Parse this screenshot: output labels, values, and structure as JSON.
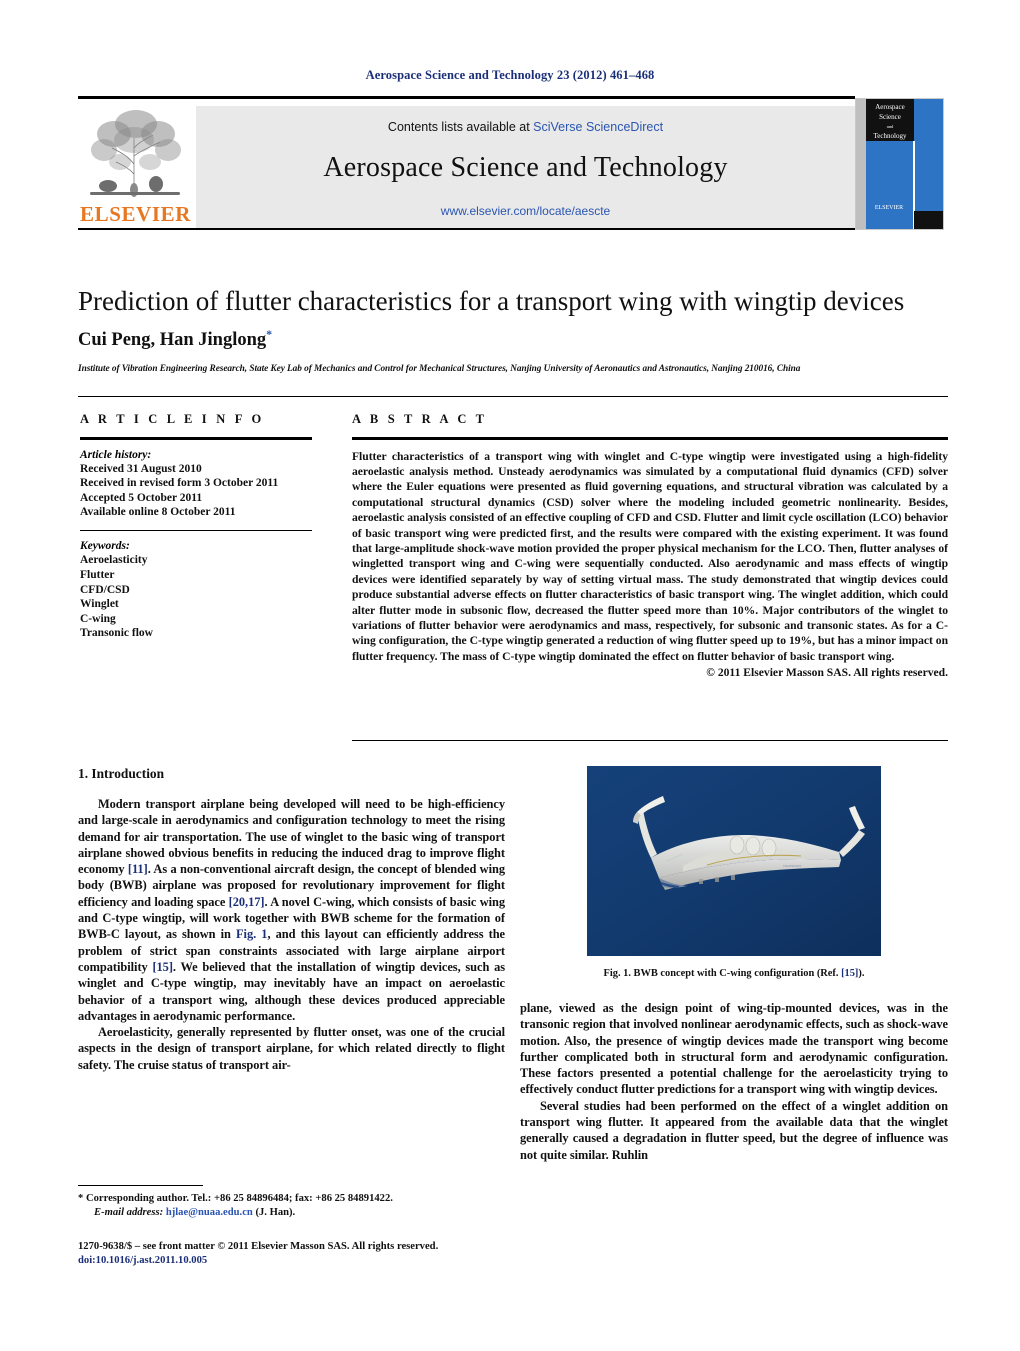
{
  "running_head": "Aerospace Science and Technology 23 (2012) 461–468",
  "masthead": {
    "contents_prefix": "Contents lists available at ",
    "sciencedirect": "SciVerse ScienceDirect",
    "journal_title": "Aerospace Science and Technology",
    "journal_url": "www.elsevier.com/locate/aescte",
    "publisher_wordmark": "ELSEVIER",
    "cover": {
      "line1": "Aerospace",
      "line2": "Science",
      "line3": "and",
      "line4": "Technology",
      "publisher": "ELSEVIER"
    }
  },
  "article": {
    "title": "Prediction of flutter characteristics for a transport wing with wingtip devices",
    "authors": "Cui Peng, Han Jinglong",
    "corresponding_marker": "*",
    "affiliation": "Institute of Vibration Engineering Research, State Key Lab of Mechanics and Control for Mechanical Structures, Nanjing University of Aeronautics and Astronautics, Nanjing 210016, China"
  },
  "article_info": {
    "heading": "A R T I C L E    I N F O",
    "history_label": "Article history:",
    "history": [
      "Received 31 August 2010",
      "Received in revised form 3 October 2011",
      "Accepted 5 October 2011",
      "Available online 8 October 2011"
    ],
    "keywords_label": "Keywords:",
    "keywords": [
      "Aeroelasticity",
      "Flutter",
      "CFD/CSD",
      "Winglet",
      "C-wing",
      "Transonic flow"
    ]
  },
  "abstract": {
    "heading": "A B S T R A C T",
    "text": "Flutter characteristics of a transport wing with winglet and C-type wingtip were investigated using a high-fidelity aeroelastic analysis method. Unsteady aerodynamics was simulated by a computational fluid dynamics (CFD) solver where the Euler equations were presented as fluid governing equations, and structural vibration was calculated by a computational structural dynamics (CSD) solver where the modeling included geometric nonlinearity. Besides, aeroelastic analysis consisted of an effective coupling of CFD and CSD. Flutter and limit cycle oscillation (LCO) behavior of basic transport wing were predicted first, and the results were compared with the existing experiment. It was found that large-amplitude shock-wave motion provided the proper physical mechanism for the LCO. Then, flutter analyses of wingletted transport wing and C-wing were sequentially conducted. Also aerodynamic and mass effects of wingtip devices were identified separately by way of setting virtual mass. The study demonstrated that wingtip devices could produce substantial adverse effects on flutter characteristics of basic transport wing. The winglet addition, which could alter flutter mode in subsonic flow, decreased the flutter speed more than 10%. Major contributors of the winglet to variations of flutter behavior were aerodynamics and mass, respectively, for subsonic and transonic states. As for a C-wing configuration, the C-type wingtip generated a reduction of wing flutter speed up to 19%, but has a minor impact on flutter frequency. The mass of C-type wingtip dominated the effect on flutter behavior of basic transport wing.",
    "copyright": "© 2011 Elsevier Masson SAS. All rights reserved."
  },
  "body": {
    "section1_heading": "1. Introduction",
    "para1_a": "Modern transport airplane being developed will need to be high-efficiency and large-scale in aerodynamics and configuration technology to meet the rising demand for air transportation. The use of winglet to the basic wing of transport airplane showed obvious benefits in reducing the induced drag to improve flight economy ",
    "ref_11": "[11]",
    "para1_b": ". As a non-conventional aircraft design, the concept of blended wing body (BWB) airplane was proposed for revolutionary improvement for flight efficiency and loading space ",
    "ref_2017": "[20,17]",
    "para1_c": ". A novel C-wing, which consists of basic wing and C-type wingtip, will work together with BWB scheme for the formation of BWB-C layout, as shown in ",
    "ref_fig1": "Fig. 1",
    "para1_d": ", and this layout can efficiently address the problem of strict span constraints associated with large airplane airport compatibility ",
    "ref_15": "[15]",
    "para1_e": ". We believed that the installation of wingtip devices, such as winglet and C-type wingtip, may inevitably have an impact on aeroelastic behavior of a transport wing, although these devices produced appreciable advantages in aerodynamic performance.",
    "para2": "Aeroelasticity, generally represented by flutter onset, was one of the crucial aspects in the design of transport airplane, for which related directly to flight safety. The cruise status of transport air-",
    "para3": "plane, viewed as the design point of wing-tip-mounted devices, was in the transonic region that involved nonlinear aerodynamic effects, such as shock-wave motion. Also, the presence of wingtip devices made the transport wing become further complicated both in structural form and aerodynamic configuration. These factors presented a potential challenge for the aeroelasticity trying to effectively conduct flutter predictions for a transport wing with wingtip devices.",
    "para4": "Several studies had been performed on the effect of a winglet addition on transport wing flutter. It appeared from the available data that the winglet generally caused a degradation in flutter speed, but the degree of influence was not quite similar. Ruhlin"
  },
  "figure": {
    "caption_text": "Fig. 1. BWB concept with C-wing configuration (Ref. ",
    "caption_ref": "[15]",
    "caption_end": ").",
    "background_color": "#123a6e"
  },
  "footnotes": {
    "corresponding": "* Corresponding author. Tel.: +86 25 84896484; fax: +86 25 84891422.",
    "email_label": "E-mail address:",
    "email": "hjlae@nuaa.edu.cn",
    "email_suffix": "(J. Han).",
    "imprint": "1270-9638/$ – see front matter © 2011 Elsevier Masson SAS. All rights reserved.",
    "doi": "doi:10.1016/j.ast.2011.10.005"
  },
  "colors": {
    "link_blue": "#2a55b0",
    "ref_blue": "#1b2f78",
    "elsevier_orange": "#e87722",
    "band_gray": "#e9e9e9",
    "cover_blue": "#2e74c4"
  }
}
